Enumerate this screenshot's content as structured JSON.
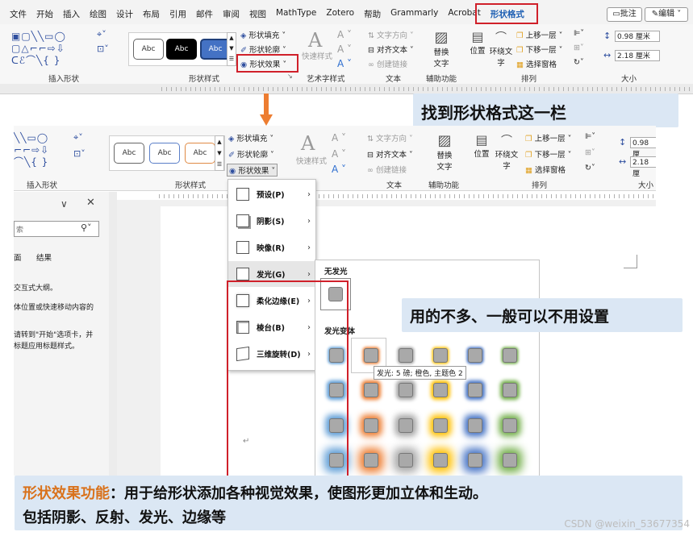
{
  "ribbon_tabs": [
    "文件",
    "开始",
    "插入",
    "绘图",
    "设计",
    "布局",
    "引用",
    "邮件",
    "审阅",
    "视图",
    "MathType",
    "Zotero",
    "帮助",
    "Grammarly",
    "Acrobat",
    "形状格式"
  ],
  "active_tab": "形状格式",
  "top_right": {
    "comment": "批注",
    "edit": "编辑"
  },
  "groups": {
    "insert_shapes": "插入形状",
    "shape_styles": "形状样式",
    "wordart_styles": "艺术字样式",
    "text": "文本",
    "accessibility": "辅助功能",
    "arrange": "排列",
    "size": "大小"
  },
  "style_box_text": "Abc",
  "shape_cmds": {
    "fill": "形状填充",
    "outline": "形状轮廓",
    "effects": "形状效果"
  },
  "wordart": {
    "quick_styles": "快速样式"
  },
  "text_cmds": {
    "direction": "文字方向",
    "align": "对齐文本",
    "link": "创建链接"
  },
  "accessibility_cmds": {
    "alt_text_l1": "替换",
    "alt_text_l2": "文字"
  },
  "arrange_cmds": {
    "position": "位置",
    "wrap_l1": "环绕文",
    "wrap_l2": "字",
    "forward": "上移一层",
    "backward": "下移一层",
    "selection_pane": "选择窗格"
  },
  "size_values": {
    "height": "0.98 厘米",
    "width": "2.18 厘米"
  },
  "size_values_cut": {
    "height": "0.98 厘",
    "width": "2.18 厘"
  },
  "banners": {
    "top": "找到形状格式这一栏",
    "mid": "用的不多、一般可以不用设置",
    "bottom_title": "形状效果功能",
    "bottom_line1": "：用于给形状添加各种视觉效果，使图形更加立体和生动。",
    "bottom_line2": "包括阴影、反射、发光、边缘等"
  },
  "nav_pane": {
    "search_placeholder": "索",
    "tab_pages": "面",
    "tab_results": "结果",
    "line1": "交互式大纲。",
    "line2": "体位置或快速移动内容的",
    "line3": "请转到\"开始\"选项卡，并",
    "line4": "标题应用标题样式。"
  },
  "effects_menu": [
    {
      "label": "预设(P)"
    },
    {
      "label": "阴影(S)"
    },
    {
      "label": "映像(R)"
    },
    {
      "label": "发光(G)"
    },
    {
      "label": "柔化边缘(E)"
    },
    {
      "label": "棱台(B)"
    },
    {
      "label": "三维旋转(D)"
    }
  ],
  "glow_panel": {
    "no_glow": "无发光",
    "variants": "发光变体"
  },
  "glow_colors": [
    "#5b9bd5",
    "#ed7d31",
    "#a5a5a5",
    "#ffc000",
    "#4472c4",
    "#70ad47"
  ],
  "tooltip": "发光: 5 磅; 橙色, 主题色 2",
  "paragraph_mark": "↵",
  "watermark": "CSDN @weixin_53677354"
}
